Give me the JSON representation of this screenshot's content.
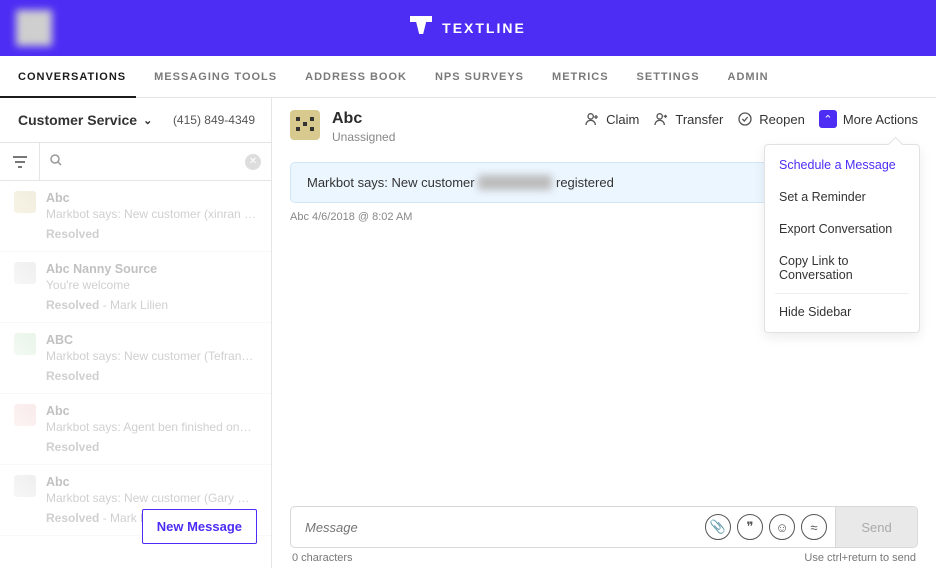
{
  "brand": {
    "name": "TEXTLINE"
  },
  "nav": {
    "tabs": [
      {
        "label": "CONVERSATIONS"
      },
      {
        "label": "MESSAGING TOOLS"
      },
      {
        "label": "ADDRESS BOOK"
      },
      {
        "label": "NPS SURVEYS"
      },
      {
        "label": "METRICS"
      },
      {
        "label": "SETTINGS"
      },
      {
        "label": "ADMIN"
      }
    ]
  },
  "sidebar": {
    "department": "Customer Service",
    "phone": "(415) 849-4349",
    "new_message_label": "New Message",
    "items": [
      {
        "title": "Abc",
        "preview": "Markbot says: New customer (xinran d…",
        "status": "Resolved",
        "assignee": ""
      },
      {
        "title": "Abc Nanny Source",
        "preview": "You're welcome",
        "status": "Resolved",
        "assignee": " - Mark Lilien"
      },
      {
        "title": "ABC",
        "preview": "Markbot says: New customer (Tefrany …",
        "status": "Resolved",
        "assignee": ""
      },
      {
        "title": "Abc",
        "preview": "Markbot says: Agent ben finished onboa…",
        "status": "Resolved",
        "assignee": ""
      },
      {
        "title": "Abc",
        "preview": "Markbot says: New customer (Gary Pau…",
        "status": "Resolved",
        "assignee": " - Mark Lilien"
      }
    ]
  },
  "conversation": {
    "name": "Abc",
    "sub": "Unassigned",
    "actions": {
      "claim": "Claim",
      "transfer": "Transfer",
      "reopen": "Reopen",
      "more": "More Actions"
    },
    "sysmsg_prefix": "Markbot says: New customer",
    "sysmsg_redacted": "xxxxx xxxx",
    "sysmsg_suffix": "registered",
    "meta": "Abc 4/6/2018 @ 8:02 AM"
  },
  "dropdown": {
    "items": [
      "Schedule a Message",
      "Set a Reminder",
      "Export Conversation",
      "Copy Link to Conversation",
      "Hide Sidebar"
    ]
  },
  "composer": {
    "placeholder": "Message",
    "char_count": "0 characters",
    "hint": "Use ctrl+return to send",
    "send_label": "Send"
  }
}
